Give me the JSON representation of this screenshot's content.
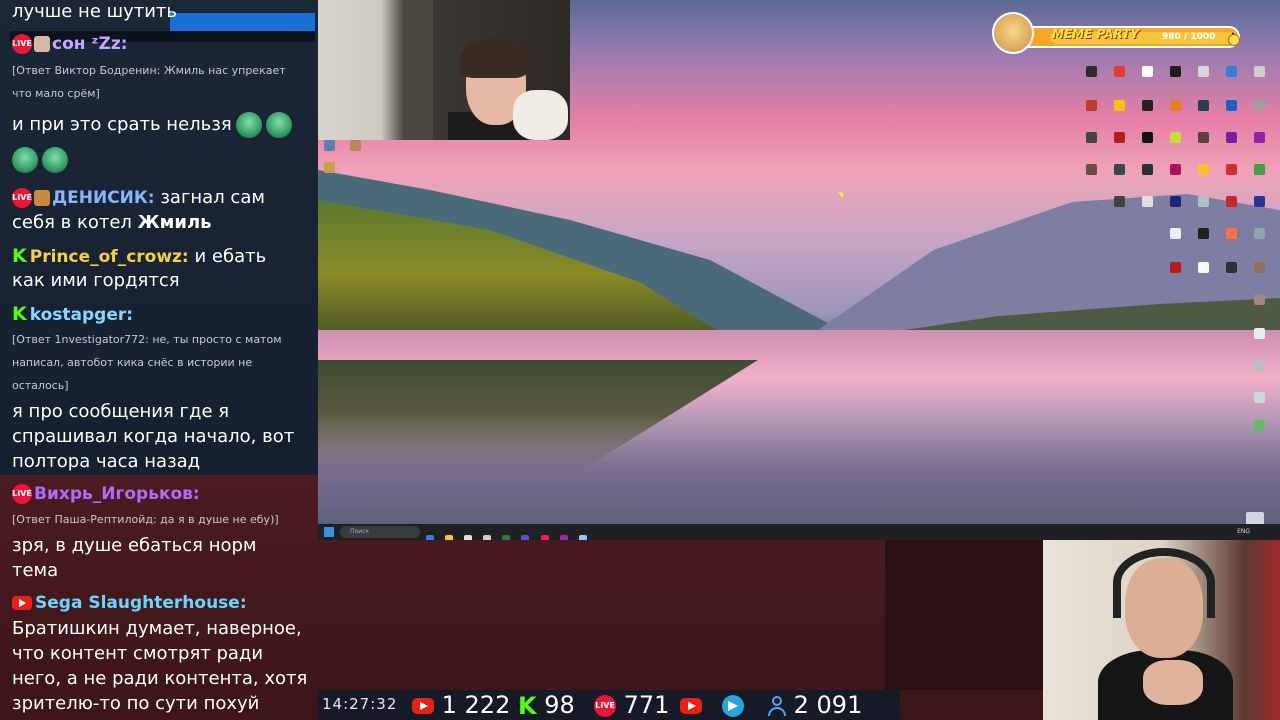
{
  "chat": {
    "messages": [
      {
        "type": "text",
        "text": "лучше не шутить"
      },
      {
        "type": "msg",
        "badge": "live",
        "user": "сон ᶻZz:",
        "color": "#c7a6ff",
        "reply": "[Ответ Виктор Бодренин: Жмиль нас упрекает что мало срём]",
        "lines": [
          "и при это срать нельзя"
        ]
      },
      {
        "type": "msg",
        "badge": "live",
        "user": "ДЕНИСИК:",
        "color": "#8ab4ff",
        "text_inline": "загнал сам",
        "lines": [
          "себя в котел Жмиль"
        ]
      },
      {
        "type": "msg",
        "badge": "kick",
        "user": "Prince_of_crowz:",
        "color": "#f5d142",
        "text_inline": "и ебать",
        "lines": [
          "как ими гордятся"
        ]
      },
      {
        "type": "msg",
        "badge": "kick",
        "user": "kostapger:",
        "color": "#8fd3ff",
        "reply": "[Ответ 1nvestigator772: не, ты просто с матом написал, автобот кика снёс в истории не осталось]",
        "lines": [
          "я про сообщения где я",
          "спрашивал когда начало, вот",
          "полтора часа назад"
        ]
      },
      {
        "type": "msg",
        "badge": "live",
        "user": "Вихрь_Игорьков:",
        "color": "#b06bff",
        "reply": "[Ответ Паша-Рептилойд: да я в душе не ебу)]",
        "lines": [
          "зря, в душе ебаться норм",
          "тема"
        ]
      },
      {
        "type": "msg",
        "badge": "yt",
        "user": "Sega Slaughterhouse:",
        "color": "#6cd4ff",
        "lines": [
          "Братишкин думает, наверное,",
          "что контент смотрят ради",
          "него, а не ради контента, хотя",
          "зрителю-то по сути похуй"
        ]
      }
    ],
    "m0": "лучше не шутить",
    "u1": "сон ᶻZz:",
    "r1a": "[Ответ Виктор Бодренин: Жмиль нас упрекает",
    "r1b": "что мало срём]",
    "t1": "и при это срать нельзя",
    "u2": "ДЕНИСИК:",
    "t2a": "загнал сам",
    "t2b": "себя в котел ",
    "t2c": "Жмиль",
    "u3": "Prince_of_crowz:",
    "t3a": "и ебать",
    "t3b": "как ими гордятся",
    "u4": "kostapger:",
    "r4a": "[Ответ 1nvestigator772: не, ты просто с матом",
    "r4b": "написал, автобот кика снёс в истории не",
    "r4c": "осталось]",
    "t4a": "я про сообщения где я",
    "t4b": "спрашивал когда начало, вот",
    "t4c": "полтора часа назад",
    "u5": "Вихрь_Игорьков:",
    "r5": "[Ответ Паша-Рептилойд: да я в душе не ебу)]",
    "t5a": "зря, в душе ебаться норм",
    "t5b": "тема",
    "u6": "Sega Slaughterhouse:",
    "t6a": "Братишкин думает, наверное,",
    "t6b": "что контент смотрят ради",
    "t6c": "него, а не ради контента, хотя",
    "t6d": "зрителю-то по сути похуй",
    "live_badge": "LIVE"
  },
  "meme_party": {
    "label": "MEME PARTY",
    "value": "980 / 1000",
    "progress": 0.98,
    "accent": "#f5a623"
  },
  "desktop": {
    "search_placeholder": "Поиск",
    "tray_time": "ENG"
  },
  "stats": {
    "time": "14:27:32",
    "youtube": "1 222",
    "kick": "98",
    "kick_icon": "K",
    "live": "771",
    "total": "2 091",
    "live_badge": "LIVE"
  },
  "icons": [
    "live-badge-icon",
    "kick-icon",
    "youtube-icon",
    "telegram-icon",
    "user-icon",
    "doge-icon",
    "coin-icon",
    "windows-start-icon",
    "recycle-bin-icon"
  ]
}
